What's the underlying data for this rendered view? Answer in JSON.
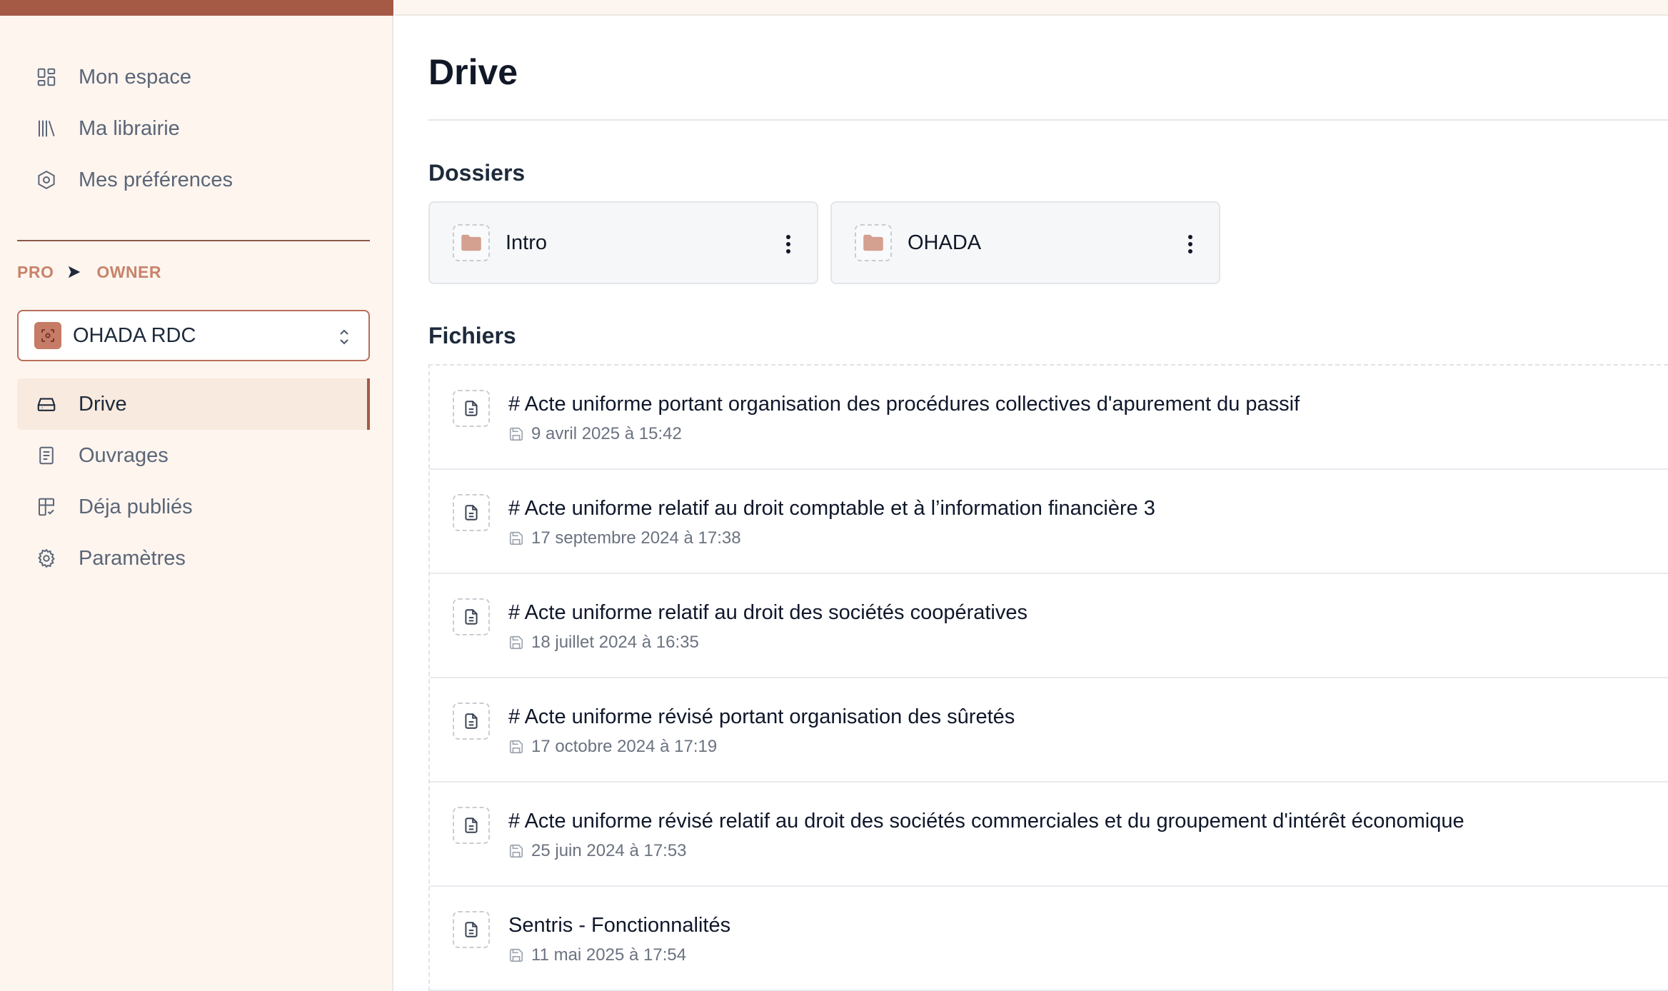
{
  "sidebar": {
    "top_nav": [
      {
        "label": "Mon espace",
        "icon": "dashboard-icon"
      },
      {
        "label": "Ma librairie",
        "icon": "library-icon"
      },
      {
        "label": "Mes préférences",
        "icon": "hexagon-settings-icon"
      }
    ],
    "role": {
      "plan": "PRO",
      "role": "OWNER"
    },
    "org_selector": {
      "name": "OHADA RDC"
    },
    "workspace_nav": [
      {
        "label": "Drive",
        "icon": "drive-icon",
        "active": true
      },
      {
        "label": "Ouvrages",
        "icon": "book-icon",
        "active": false
      },
      {
        "label": "Déja publiés",
        "icon": "layout-check-icon",
        "active": false
      },
      {
        "label": "Paramètres",
        "icon": "gear-icon",
        "active": false
      }
    ]
  },
  "main": {
    "title": "Drive",
    "folders_title": "Dossiers",
    "folders": [
      {
        "name": "Intro"
      },
      {
        "name": "OHADA"
      }
    ],
    "files_title": "Fichiers",
    "files": [
      {
        "title": "# Acte uniforme portant organisation des procédures collectives d'apurement du passif",
        "date": "9 avril 2025 à 15:42"
      },
      {
        "title": "# Acte uniforme relatif au droit comptable et à l’information financière 3",
        "date": "17 septembre 2024 à 17:38"
      },
      {
        "title": "# Acte uniforme relatif au droit des sociétés coopératives",
        "date": "18 juillet 2024 à 16:35"
      },
      {
        "title": "# Acte uniforme révisé portant organisation des sûretés",
        "date": "17 octobre 2024 à 17:19"
      },
      {
        "title": "# Acte uniforme révisé relatif au droit des sociétés commerciales et du groupement d'intérêt économique",
        "date": "25 juin 2024 à 17:53"
      },
      {
        "title": "Sentris - Fonctionnalités",
        "date": "11 mai 2025 à 17:54"
      }
    ]
  },
  "colors": {
    "accent": "#a45a45",
    "sidebar_bg": "#fef5ef",
    "folder_icon": "#d4a090"
  }
}
